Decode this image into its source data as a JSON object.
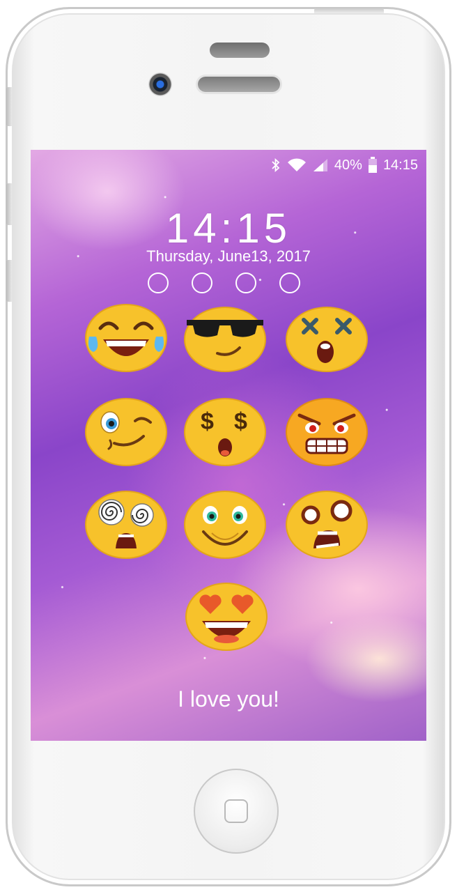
{
  "status_bar": {
    "battery_percent": "40%",
    "time": "14:15",
    "icons": [
      "bluetooth-icon",
      "wifi-icon",
      "signal-icon",
      "battery-icon"
    ]
  },
  "lock_screen": {
    "clock": "14:15",
    "date": "Thursday, June13, 2017",
    "pin_dots_filled": 0,
    "pin_dots_total": 4,
    "caption": "I love you!",
    "keys": [
      "tears-of-joy-emoji",
      "sunglasses-emoji",
      "dizzy-x-eyes-emoji",
      "winking-emoji",
      "money-eyes-emoji",
      "angry-emoji",
      "hypnotized-emoji",
      "smiling-emoji",
      "shocked-emoji",
      "heart-eyes-emoji"
    ]
  },
  "colors": {
    "emoji_face": "#f7c22b",
    "background_accent": "#9b4fcf"
  }
}
